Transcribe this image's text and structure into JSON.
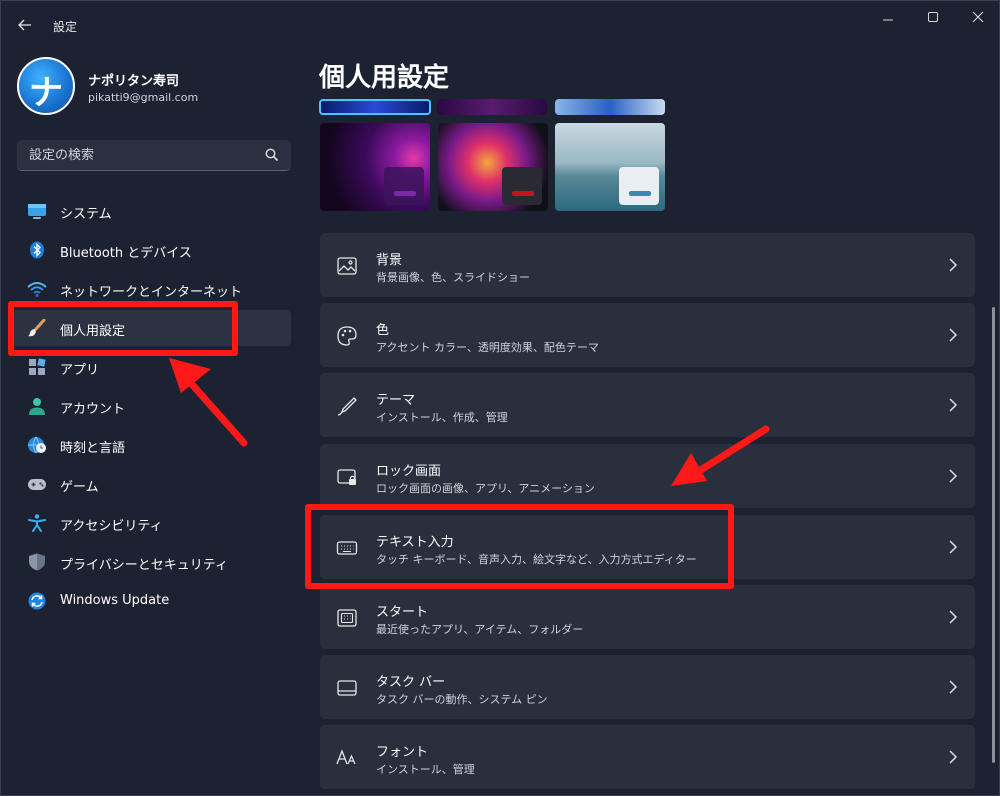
{
  "window": {
    "title": "設定",
    "back_label": "←",
    "min_label": "—",
    "max_label": "☐",
    "close_label": "✕"
  },
  "profile": {
    "name": "ナポリタン寿司",
    "email": "pikatti9@gmail.com",
    "avatar_glyph": "ナ"
  },
  "search": {
    "placeholder": "設定の検索"
  },
  "nav": {
    "items": [
      {
        "label": "システム",
        "icon": "monitor-icon"
      },
      {
        "label": "Bluetooth とデバイス",
        "icon": "bluetooth-icon"
      },
      {
        "label": "ネットワークとインターネット",
        "icon": "wifi-icon"
      },
      {
        "label": "個人用設定",
        "icon": "paintbrush-icon",
        "selected": true
      },
      {
        "label": "アプリ",
        "icon": "apps-icon"
      },
      {
        "label": "アカウント",
        "icon": "person-icon"
      },
      {
        "label": "時刻と言語",
        "icon": "globe-clock-icon"
      },
      {
        "label": "ゲーム",
        "icon": "gamepad-icon"
      },
      {
        "label": "アクセシビリティ",
        "icon": "accessibility-icon"
      },
      {
        "label": "プライバシーとセキュリティ",
        "icon": "shield-icon"
      },
      {
        "label": "Windows Update",
        "icon": "update-icon"
      }
    ]
  },
  "main": {
    "title": "個人用設定",
    "themes": {
      "mini_bar_colors": [
        "#7a2aa8",
        "#c4141e",
        "#3a8ab0"
      ]
    },
    "cards": [
      {
        "title": "背景",
        "subtitle": "背景画像、色、スライドショー",
        "icon": "picture-icon"
      },
      {
        "title": "色",
        "subtitle": "アクセント カラー、透明度効果、配色テーマ",
        "icon": "palette-icon"
      },
      {
        "title": "テーマ",
        "subtitle": "インストール、作成、管理",
        "icon": "brush-icon"
      },
      {
        "title": "ロック画面",
        "subtitle": "ロック画面の画像、アプリ、アニメーション",
        "icon": "lock-screen-icon"
      },
      {
        "title": "テキスト入力",
        "subtitle": "タッチ キーボード、音声入力、絵文字など、入力方式エディター",
        "icon": "keyboard-icon"
      },
      {
        "title": "スタート",
        "subtitle": "最近使ったアプリ、アイテム、フォルダー",
        "icon": "start-icon"
      },
      {
        "title": "タスク バー",
        "subtitle": "タスク バーの動作、システム ピン",
        "icon": "taskbar-icon"
      },
      {
        "title": "フォント",
        "subtitle": "インストール、管理",
        "icon": "font-icon"
      }
    ]
  },
  "colors": {
    "accent": "#4cc2ff",
    "highlight": "#ff1818",
    "background": "#1d2232",
    "card": "#2a2f3e"
  }
}
